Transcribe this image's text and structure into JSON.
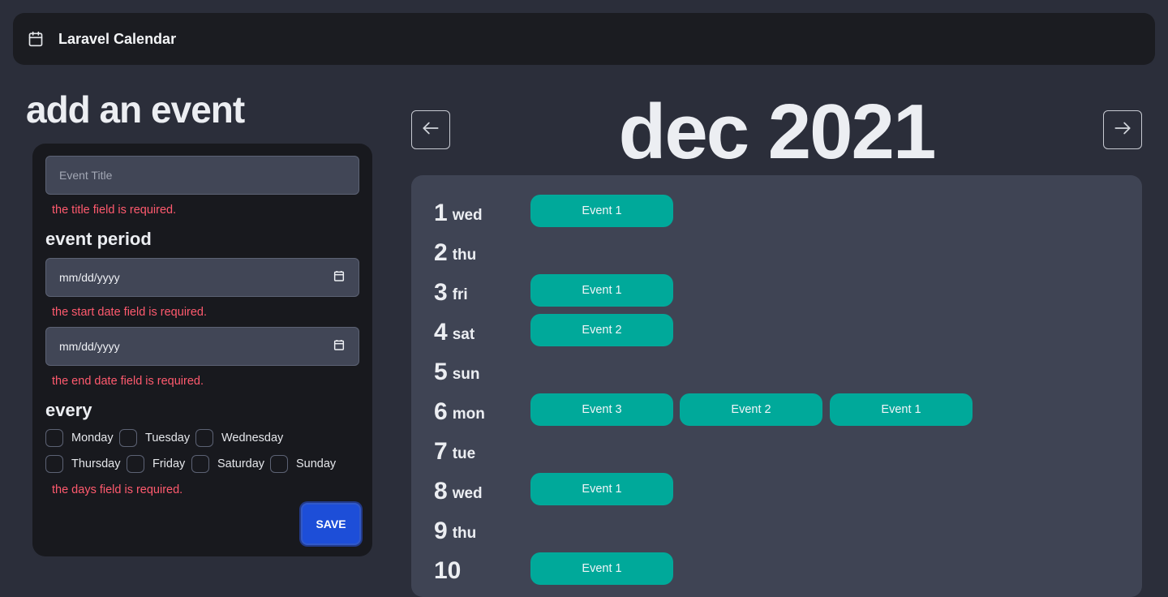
{
  "app": {
    "title": "Laravel Calendar",
    "icon": "calendar-icon"
  },
  "form": {
    "heading": "add an event",
    "title_placeholder": "Event Title",
    "title_error": "the title field is required.",
    "period_label": "event period",
    "start_date_value": "mm/dd/yyyy",
    "start_date_error": "the start date field is required.",
    "end_date_value": "mm/dd/yyyy",
    "end_date_error": "the end date field is required.",
    "every_label": "every",
    "days": [
      "Monday",
      "Tuesday",
      "Wednesday",
      "Thursday",
      "Friday",
      "Saturday",
      "Sunday"
    ],
    "days_error": "the days field is required.",
    "save_label": "SAVE"
  },
  "calendar": {
    "month_title": "dec 2021",
    "prev_icon": "arrow-left-icon",
    "next_icon": "arrow-right-icon",
    "days": [
      {
        "num": "1",
        "name": "wed",
        "events": [
          "Event 1"
        ]
      },
      {
        "num": "2",
        "name": "thu",
        "events": []
      },
      {
        "num": "3",
        "name": "fri",
        "events": [
          "Event 1"
        ]
      },
      {
        "num": "4",
        "name": "sat",
        "events": [
          "Event 2"
        ]
      },
      {
        "num": "5",
        "name": "sun",
        "events": []
      },
      {
        "num": "6",
        "name": "mon",
        "events": [
          "Event 3",
          "Event 2",
          "Event 1"
        ]
      },
      {
        "num": "7",
        "name": "tue",
        "events": []
      },
      {
        "num": "8",
        "name": "wed",
        "events": [
          "Event 1"
        ]
      },
      {
        "num": "9",
        "name": "thu",
        "events": []
      },
      {
        "num": "10",
        "name": "",
        "events": [
          "Event 1"
        ]
      }
    ]
  },
  "colors": {
    "background": "#2b2e3a",
    "event": "#00a99a",
    "error": "#ff5a6e",
    "save_button": "#1d4ed8"
  }
}
